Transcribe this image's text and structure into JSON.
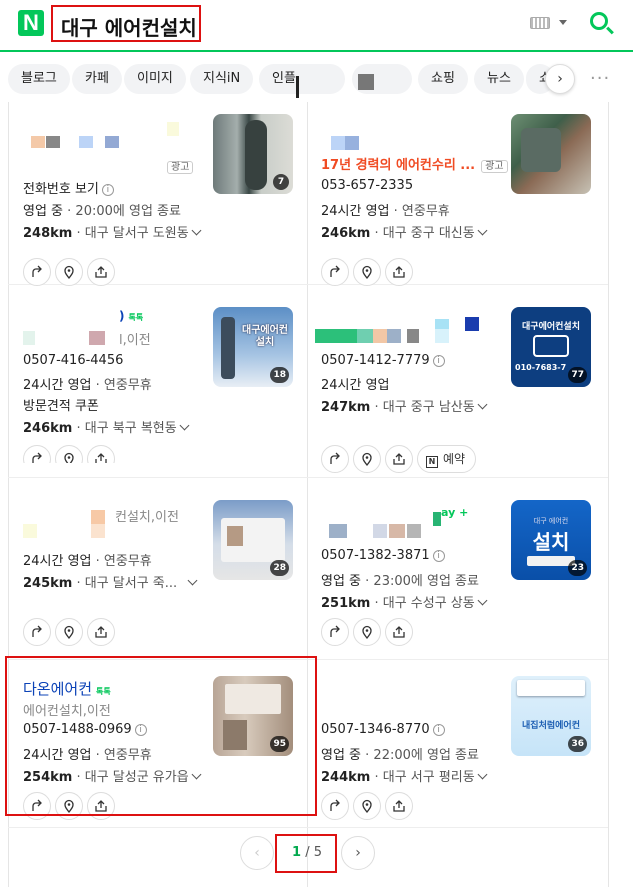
{
  "header": {
    "logo": "N",
    "query": "대구 에어컨설치"
  },
  "tabs": [
    "블로그",
    "카페",
    "이미지",
    "지식iN",
    "인플",
    "쇼핑",
    "뉴스",
    "쇼"
  ],
  "cards": [
    {
      "title": "",
      "ad": "광고",
      "line1": "전화번호 보기",
      "hours_a": "영업 중",
      "hours_b": "20:00에 영업 종료",
      "dist": "248km",
      "addr": "대구 달서구 도원동",
      "photos": "7"
    },
    {
      "title": "17년 경력의 에어컨수리 ...",
      "ad": "광고",
      "line1": "053-657-2335",
      "hours_a": "24시간 영업",
      "hours_b": "연중무휴",
      "dist": "246km",
      "addr": "대구 중구 대신동",
      "photos": ""
    },
    {
      "title": "",
      "talk": "톡톡",
      "cat": "l,이전",
      "line1": "0507-416-4456",
      "hours_a": "24시간 영업",
      "hours_b": "연중무휴",
      "extra": "방문견적 쿠폰",
      "dist": "246km",
      "addr": "대구 북구 복현동",
      "photos": "18",
      "thumb_text": "대구에어컨 설치"
    },
    {
      "title": "",
      "line1": "0507-1412-7779",
      "hours_a": "24시간 영업",
      "dist": "247km",
      "addr": "대구 중구 남산동",
      "photos": "77",
      "thumb_text": "대구에어컨설치",
      "thumb_phone": "010-7683-7",
      "book": "예약"
    },
    {
      "title": "",
      "cat": "컨설치,이전",
      "line1": "",
      "hours_a": "24시간 영업",
      "hours_b": "연중무휴",
      "dist": "245km",
      "addr": "대구 달서구 죽...",
      "photos": "28"
    },
    {
      "title": "",
      "pay": "ay +",
      "line1": "0507-1382-3871",
      "hours_a": "영업 중",
      "hours_b": "23:00에 영업 종료",
      "dist": "251km",
      "addr": "대구 수성구 상동",
      "photos": "23",
      "thumb_small": "대구 에어컨",
      "thumb_text": "설치"
    },
    {
      "title": "다온에어컨",
      "talk": "톡톡",
      "cat": "에어컨설치,이전",
      "line1": "0507-1488-0969",
      "hours_a": "24시간 영업",
      "hours_b": "연중무휴",
      "dist": "254km",
      "addr": "대구 달성군 유가읍",
      "photos": "95"
    },
    {
      "title": "",
      "line1": "0507-1346-8770",
      "hours_a": "영업 중",
      "hours_b": "22:00에 영업 종료",
      "dist": "244km",
      "addr": "대구 서구 평리동",
      "photos": "36",
      "thumb_text": "내집처럼에어컨"
    }
  ],
  "pagination": {
    "current": "1",
    "separator": "/",
    "total": "5"
  },
  "colors": {
    "brand": "#03c75a",
    "ad_title": "#f04b23",
    "title_blue": "#0c43b7",
    "highlight": "#dd1111"
  }
}
